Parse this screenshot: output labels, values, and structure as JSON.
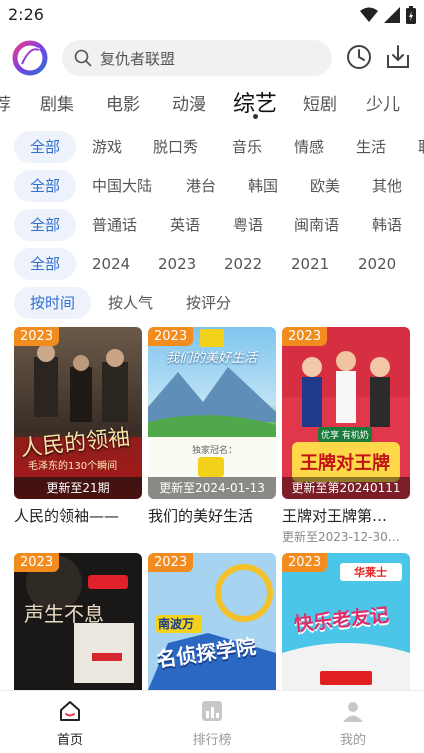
{
  "status": {
    "time": "2:26"
  },
  "search": {
    "placeholder": "复仇者联盟"
  },
  "tabs": [
    {
      "label": "荐"
    },
    {
      "label": "剧集"
    },
    {
      "label": "电影"
    },
    {
      "label": "动漫"
    },
    {
      "label": "综艺"
    },
    {
      "label": "短剧"
    },
    {
      "label": "少儿"
    }
  ],
  "active_tab": "综艺",
  "filters": {
    "type": [
      "全部",
      "游戏",
      "脱口秀",
      "音乐",
      "情感",
      "生活",
      "职"
    ],
    "region": [
      "全部",
      "中国大陆",
      "港台",
      "韩国",
      "欧美",
      "其他"
    ],
    "language": [
      "全部",
      "普通话",
      "英语",
      "粤语",
      "闽南语",
      "韩语"
    ],
    "year": [
      "全部",
      "2024",
      "2023",
      "2022",
      "2021",
      "2020"
    ],
    "sort": [
      "按时间",
      "按人气",
      "按评分"
    ]
  },
  "accent_color": "#2f6fd1",
  "badge_color": "#f28c1e",
  "cards": [
    {
      "year": "2023",
      "update": "更新至21期",
      "title": "人民的领袖——",
      "subtitle": "",
      "poster_text": "人民的领袖",
      "poster_sub": "毛泽东的130个瞬间"
    },
    {
      "year": "2023",
      "update": "更新至2024-01-13",
      "title": "我们的美好生活",
      "subtitle": "",
      "poster_text": "我们的美好生活",
      "poster_sub": "独家冠名："
    },
    {
      "year": "2023",
      "update": "更新至第20240111",
      "title": "王牌对王牌第…",
      "subtitle": "更新至2023-12-30…",
      "poster_text": "王牌对王牌",
      "poster_sub": "优享 有机奶"
    },
    {
      "year": "2023",
      "update": "",
      "title": "",
      "subtitle": "",
      "poster_text": "声生不息",
      "poster_sub": ""
    },
    {
      "year": "2023",
      "update": "",
      "title": "",
      "subtitle": "",
      "poster_text": "名侦探学院",
      "poster_sub": "南波万"
    },
    {
      "year": "2023",
      "update": "",
      "title": "",
      "subtitle": "",
      "poster_text": "快乐老友记",
      "poster_sub": "华莱士"
    }
  ],
  "bottom_nav": [
    {
      "label": "首页"
    },
    {
      "label": "排行榜"
    },
    {
      "label": "我的"
    }
  ]
}
